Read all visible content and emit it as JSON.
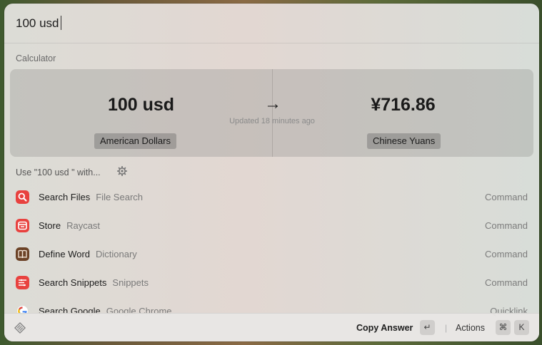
{
  "search": {
    "query": "100 usd"
  },
  "calculator": {
    "section_title": "Calculator",
    "input_value": "100 usd",
    "input_unit": "American Dollars",
    "arrow": "→",
    "updated": "Updated 18 minutes ago",
    "output_value": "¥716.86",
    "output_unit": "Chinese Yuans"
  },
  "use_with": {
    "label": "Use \"100 usd \" with...",
    "icon": "gear-icon"
  },
  "list": [
    {
      "title": "Search Files",
      "subtitle": "File Search",
      "accessory": "Command",
      "icon": "search-files-icon",
      "color": "#e8423f"
    },
    {
      "title": "Store",
      "subtitle": "Raycast",
      "accessory": "Command",
      "icon": "store-icon",
      "color": "#e8423f"
    },
    {
      "title": "Define Word",
      "subtitle": "Dictionary",
      "accessory": "Command",
      "icon": "dictionary-book-icon",
      "color": "#6b4226"
    },
    {
      "title": "Search Snippets",
      "subtitle": "Snippets",
      "accessory": "Command",
      "icon": "snippets-icon",
      "color": "#e8423f"
    },
    {
      "title": "Search Google",
      "subtitle": "Google Chrome",
      "accessory": "Quicklink",
      "icon": "google-icon",
      "color": "#ffffff"
    }
  ],
  "footer": {
    "logo": "raycast-logo-icon",
    "primary_action": "Copy Answer",
    "primary_key": "↵",
    "actions_label": "Actions",
    "actions_key_1": "⌘",
    "actions_key_2": "K"
  }
}
